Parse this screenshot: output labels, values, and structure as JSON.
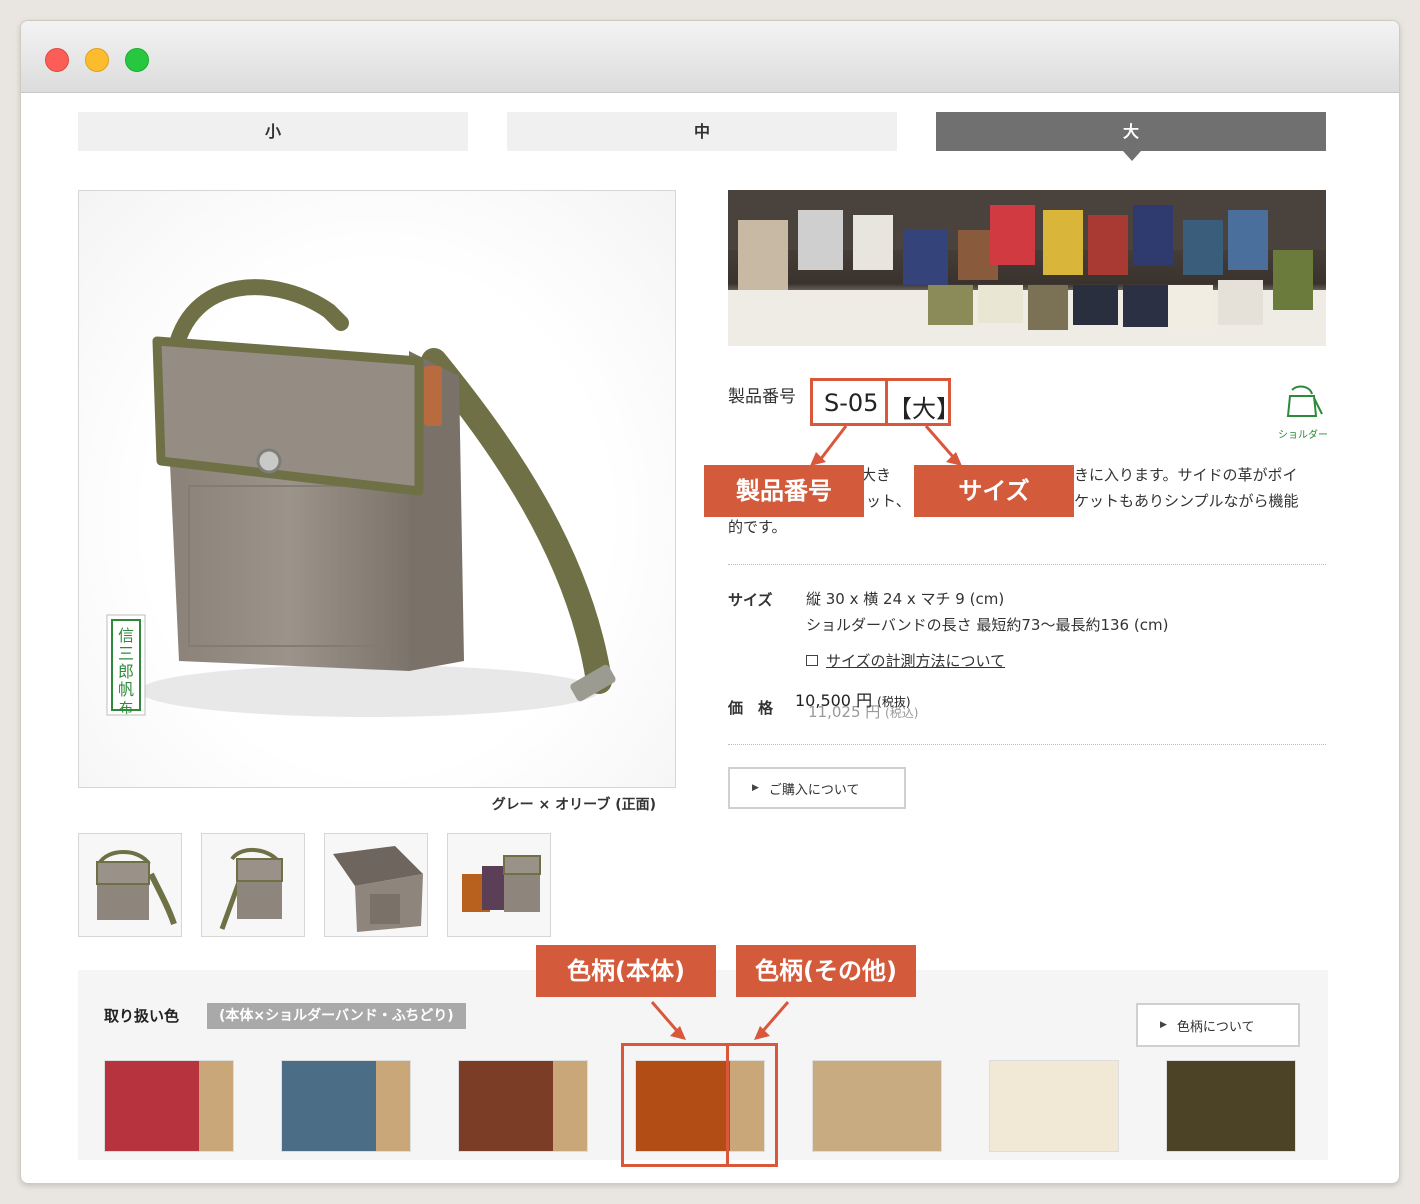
{
  "window": {
    "controls": [
      "close",
      "minimize",
      "zoom"
    ]
  },
  "size_tabs": [
    {
      "label": "小",
      "active": false
    },
    {
      "label": "中",
      "active": false
    },
    {
      "label": "大",
      "active": true
    }
  ],
  "product_image": {
    "caption": "グレー × オリーブ (正面)",
    "stamp_text": "信三郎帆布"
  },
  "thumbnails": [
    "thumb-front",
    "thumb-angle",
    "thumb-open",
    "thumb-colors"
  ],
  "product": {
    "number_label": "製品番号",
    "number": "S-05",
    "size_tag": "【大】",
    "category_icon_label": "ショルダー",
    "description_line1": "り大き",
    "description_line1b": "きに入ります。サイドの革がポイ",
    "description_line2a": "ット、",
    "description_line2b": "ケットもありシンプルながら機能",
    "description_line3": "的です。",
    "size_label": "サイズ",
    "size_value1": "縦 30 x 横 24 x マチ 9 (cm)",
    "size_value2": "ショルダーバンドの長さ 最短約73〜最長約136 (cm)",
    "size_link": "サイズの計測方法について",
    "price_label": "価　格",
    "price_main": "10,500 円",
    "price_main_note": "(税抜)",
    "price_sub": "11,025 円",
    "price_sub_note": "(税込)",
    "purchase_button": "ご購入について"
  },
  "annotations": {
    "product_number": "製品番号",
    "size": "サイズ",
    "color_body": "色柄(本体)",
    "color_other": "色柄(その他)",
    "accent_color": "#d35a3b"
  },
  "colors": {
    "label": "取り扱い色",
    "sub_label": "(本体×ショルダーバンド・ふちどり)",
    "about_button": "色柄について",
    "swatches": [
      {
        "name": "red-beige",
        "main": "#b7343f",
        "side": "#c9a778",
        "split": 0.72
      },
      {
        "name": "blue-beige",
        "main": "#4b6d86",
        "side": "#c9a778",
        "split": 0.72
      },
      {
        "name": "brown-beige",
        "main": "#7b3d26",
        "side": "#c9a778",
        "split": 0.72
      },
      {
        "name": "orange-beige",
        "main": "#b24e15",
        "side": "#c9a778",
        "split": 0.72
      },
      {
        "name": "beige",
        "main": "#c8ab80",
        "side": "#c8ab80",
        "split": 1
      },
      {
        "name": "cream",
        "main": "#f1e8d6",
        "side": "#f1e8d6",
        "split": 1
      },
      {
        "name": "olive",
        "main": "#4c4225",
        "side": "#4c4225",
        "split": 1
      }
    ]
  }
}
